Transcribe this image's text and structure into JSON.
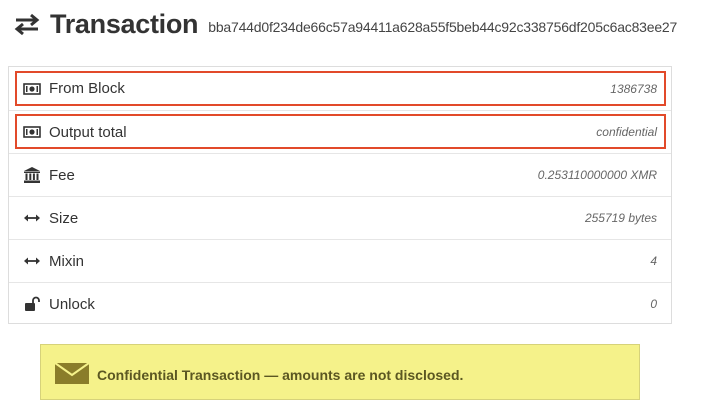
{
  "header": {
    "title": "Transaction",
    "hash": "bba744d0f234de66c57a94411a628a55f5beb44c92c338756df205c6ac83ee27",
    "icon": "exchange-arrows-icon"
  },
  "details": {
    "rows": [
      {
        "label": "From Block",
        "value": "1386738",
        "icon": "money-icon",
        "highlighted": true
      },
      {
        "label": "Output total",
        "value": "confidential",
        "icon": "money-icon",
        "highlighted": true
      },
      {
        "label": "Fee",
        "value": "0.253110000000 XMR",
        "icon": "bank-icon",
        "highlighted": false
      },
      {
        "label": "Size",
        "value": "255719 bytes",
        "icon": "horizontal-arrows-icon",
        "highlighted": false
      },
      {
        "label": "Mixin",
        "value": "4",
        "icon": "horizontal-arrows-icon",
        "highlighted": false
      },
      {
        "label": "Unlock",
        "value": "0",
        "icon": "unlock-icon",
        "highlighted": false
      }
    ]
  },
  "notice": {
    "text": "Confidential Transaction — amounts are not disclosed.",
    "icon": "envelope-icon"
  },
  "colors": {
    "highlight_border": "#e24a2a",
    "notice_background": "#f5f28a",
    "notice_text": "#5b5722",
    "envelope": "#8a7d2a"
  }
}
